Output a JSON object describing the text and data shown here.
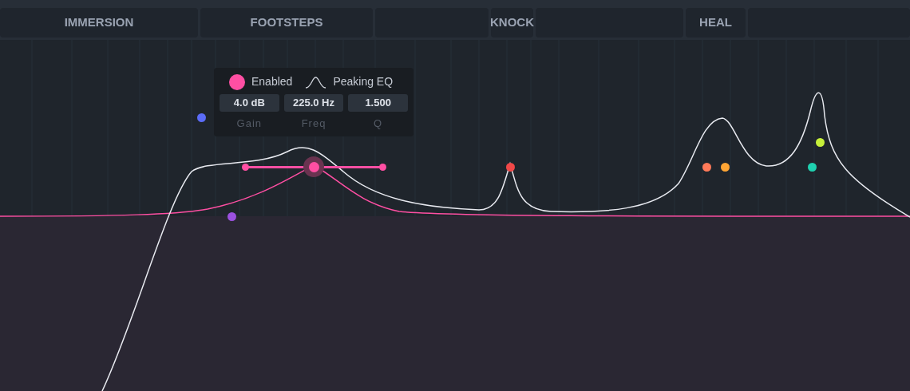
{
  "tabs": [
    {
      "label": "IMMERSION",
      "selected": false
    },
    {
      "label": "FOOTSTEPS",
      "selected": false
    },
    {
      "selected": false
    },
    {
      "label": "KNOCK",
      "selected": false
    },
    {
      "selected": false
    },
    {
      "label": "HEAL",
      "selected": false
    },
    {
      "selected": false
    }
  ],
  "bands": [
    {
      "color": "#5b6cf7",
      "selected": false
    },
    {
      "color": "#9b51e0",
      "selected": false
    },
    {
      "color": "#ff4fa3",
      "selected": true
    },
    {
      "color": "#f04848",
      "selected": false
    },
    {
      "color": "#ff7a59",
      "selected": false
    },
    {
      "color": "#ffa534",
      "selected": false
    },
    {
      "color": "#1fd1b0",
      "selected": false
    },
    {
      "color": "#c6f03a",
      "selected": false
    }
  ],
  "band_popup": {
    "enabled": true,
    "enabled_label": "Enabled",
    "filter_label": "Peaking EQ",
    "fields": [
      {
        "value": "4.0 dB",
        "label": "Gain"
      },
      {
        "value": "225.0 Hz",
        "label": "Freq"
      },
      {
        "value": "1.500",
        "label": "Q"
      }
    ]
  }
}
